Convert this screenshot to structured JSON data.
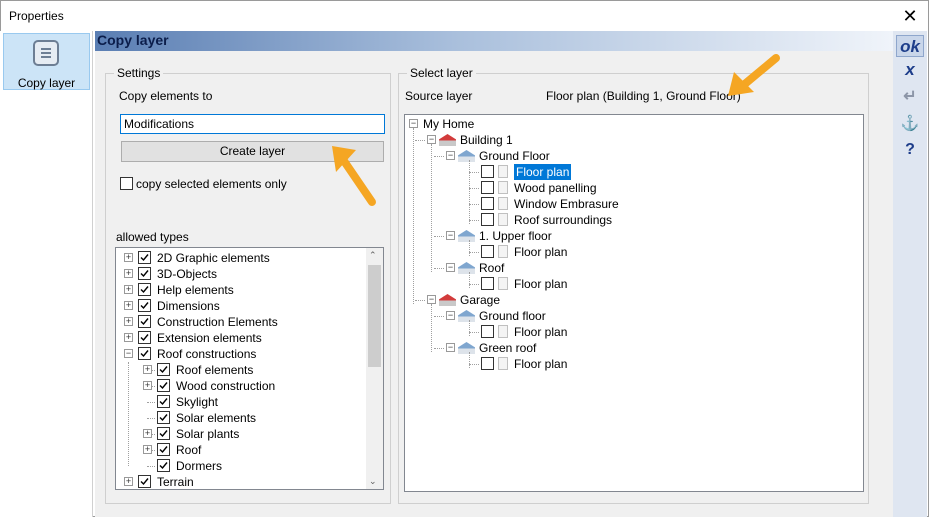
{
  "window": {
    "title": "Properties"
  },
  "sidebar": {
    "items": [
      {
        "label": "Copy layer"
      }
    ]
  },
  "header": {
    "title": "Copy layer"
  },
  "right_toolbar": {
    "ok": "ok",
    "cancel": "x",
    "enter": "↵",
    "anchor": "⚓",
    "help": "?"
  },
  "settings": {
    "group_title": "Settings",
    "copy_to_label": "Copy elements to",
    "copy_to_value": "Modifications",
    "create_button": "Create layer",
    "copy_selected_label": "copy selected elements only",
    "copy_selected_checked": false,
    "allowed_types_label": "allowed types",
    "allowed_types": [
      {
        "label": "2D Graphic elements",
        "level": 0,
        "expander": "+",
        "checked": true
      },
      {
        "label": "3D-Objects",
        "level": 0,
        "expander": "+",
        "checked": true
      },
      {
        "label": "Help elements",
        "level": 0,
        "expander": "+",
        "checked": true
      },
      {
        "label": "Dimensions",
        "level": 0,
        "expander": "+",
        "checked": true
      },
      {
        "label": "Construction Elements",
        "level": 0,
        "expander": "+",
        "checked": true
      },
      {
        "label": "Extension elements",
        "level": 0,
        "expander": "+",
        "checked": true
      },
      {
        "label": "Roof constructions",
        "level": 0,
        "expander": "-",
        "checked": true
      },
      {
        "label": "Roof elements",
        "level": 1,
        "expander": "+",
        "checked": true
      },
      {
        "label": "Wood construction",
        "level": 1,
        "expander": "+",
        "checked": true
      },
      {
        "label": "Skylight",
        "level": 1,
        "expander": "",
        "checked": true
      },
      {
        "label": "Solar elements",
        "level": 1,
        "expander": "",
        "checked": true
      },
      {
        "label": "Solar plants",
        "level": 1,
        "expander": "+",
        "checked": true
      },
      {
        "label": "Roof",
        "level": 1,
        "expander": "+",
        "checked": true
      },
      {
        "label": "Dormers",
        "level": 1,
        "expander": "",
        "checked": true
      },
      {
        "label": "Terrain",
        "level": 0,
        "expander": "+",
        "checked": true
      }
    ]
  },
  "select_layer": {
    "group_title": "Select layer",
    "source_label": "Source layer",
    "source_value": "Floor plan (Building 1, Ground Floor)",
    "tree": [
      {
        "label": "My Home",
        "level": 0,
        "kind": "root",
        "expander": "-"
      },
      {
        "label": "Building 1",
        "level": 1,
        "kind": "building",
        "expander": "-"
      },
      {
        "label": "Ground Floor",
        "level": 2,
        "kind": "floor",
        "expander": "-"
      },
      {
        "label": "Floor plan",
        "level": 3,
        "kind": "layer",
        "selected": true
      },
      {
        "label": "Wood panelling",
        "level": 3,
        "kind": "layer"
      },
      {
        "label": "Window Embrasure",
        "level": 3,
        "kind": "layer"
      },
      {
        "label": "Roof surroundings",
        "level": 3,
        "kind": "layer"
      },
      {
        "label": "1. Upper floor",
        "level": 2,
        "kind": "floor",
        "expander": "-"
      },
      {
        "label": "Floor plan",
        "level": 3,
        "kind": "layer"
      },
      {
        "label": "Roof",
        "level": 2,
        "kind": "floor",
        "expander": "-"
      },
      {
        "label": "Floor plan",
        "level": 3,
        "kind": "layer"
      },
      {
        "label": "Garage",
        "level": 1,
        "kind": "building",
        "expander": "-"
      },
      {
        "label": "Ground floor",
        "level": 2,
        "kind": "floor",
        "expander": "-"
      },
      {
        "label": "Floor plan",
        "level": 3,
        "kind": "layer"
      },
      {
        "label": "Green roof",
        "level": 2,
        "kind": "floor",
        "expander": "-"
      },
      {
        "label": "Floor plan",
        "level": 3,
        "kind": "layer"
      }
    ]
  },
  "colors": {
    "accent": "#0078d7",
    "header_dark": "#5a7eb3",
    "arrow": "#f5a623"
  }
}
